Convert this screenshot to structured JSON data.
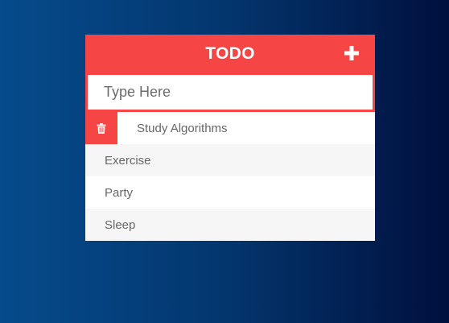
{
  "header": {
    "title": "TODO",
    "add_icon": "plus-icon"
  },
  "input": {
    "placeholder": "Type Here",
    "value": ""
  },
  "todos": [
    {
      "label": "Study Algorithms",
      "show_delete": true,
      "delete_icon": "trash-icon"
    },
    {
      "label": "Exercise",
      "show_delete": false
    },
    {
      "label": "Party",
      "show_delete": false
    },
    {
      "label": "Sleep",
      "show_delete": false
    }
  ],
  "colors": {
    "accent": "#f64545",
    "background_start": "#064b8c",
    "background_end": "#010f3d",
    "row_alt": "#f6f6f6",
    "text": "#666666"
  }
}
